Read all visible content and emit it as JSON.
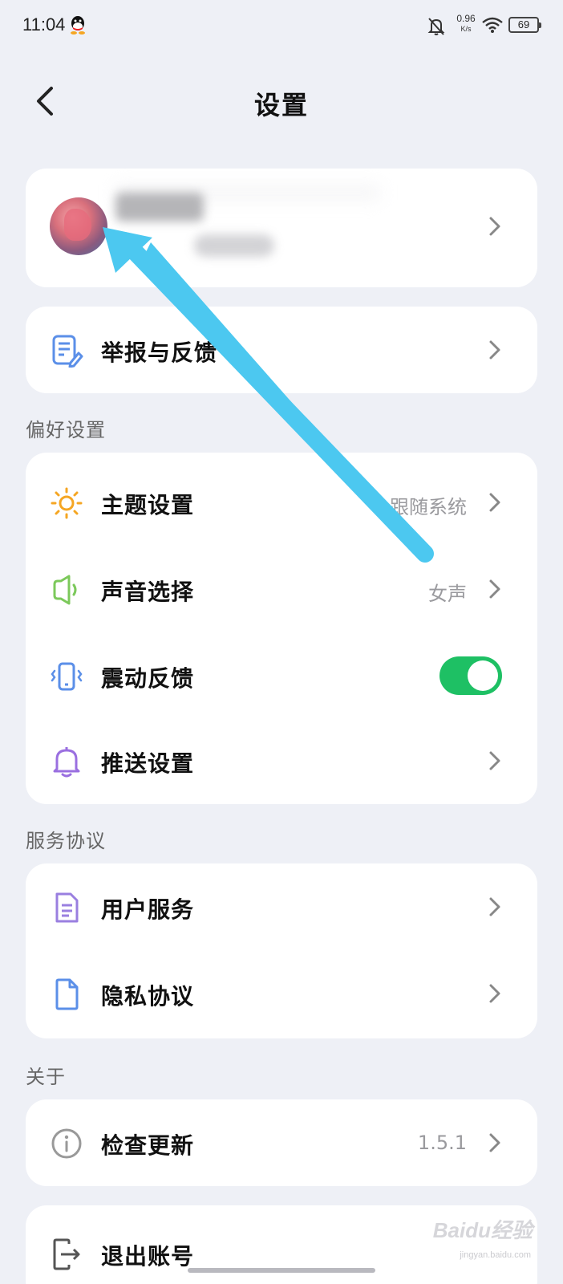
{
  "status_bar": {
    "time": "11:04",
    "net_speed_value": "0.96",
    "net_speed_unit": "K/s",
    "battery": "69",
    "icons": [
      "qq-icon",
      "bell-off-icon",
      "wifi-icon",
      "battery-icon"
    ]
  },
  "header": {
    "title": "设置",
    "back_icon": "chevron-left-icon"
  },
  "profile": {
    "avatar": "avatar-image"
  },
  "feedback": {
    "label": "举报与反馈",
    "icon": "edit-doc-icon"
  },
  "preferences": {
    "section_title": "偏好设置",
    "items": [
      {
        "label": "主题设置",
        "value": "跟随系统",
        "icon": "sun-icon"
      },
      {
        "label": "声音选择",
        "value": "女声",
        "icon": "speaker-icon"
      },
      {
        "label": "震动反馈",
        "toggle_on": true,
        "icon": "vibrate-icon"
      },
      {
        "label": "推送设置",
        "icon": "bell-icon"
      }
    ]
  },
  "agreements": {
    "section_title": "服务协议",
    "items": [
      {
        "label": "用户服务",
        "icon": "document-icon"
      },
      {
        "label": "隐私协议",
        "icon": "file-icon"
      }
    ]
  },
  "about": {
    "section_title": "关于",
    "items": [
      {
        "label": "检查更新",
        "value": "1.5.1",
        "icon": "info-icon"
      }
    ]
  },
  "logout": {
    "label": "退出账号",
    "icon": "logout-icon"
  },
  "watermark": {
    "text": "Baidu经验",
    "sub": "jingyan.baidu.com"
  },
  "colors": {
    "background": "#eef0f6",
    "toggle_on": "#1ec064",
    "arrow": "#4cc8f0"
  }
}
